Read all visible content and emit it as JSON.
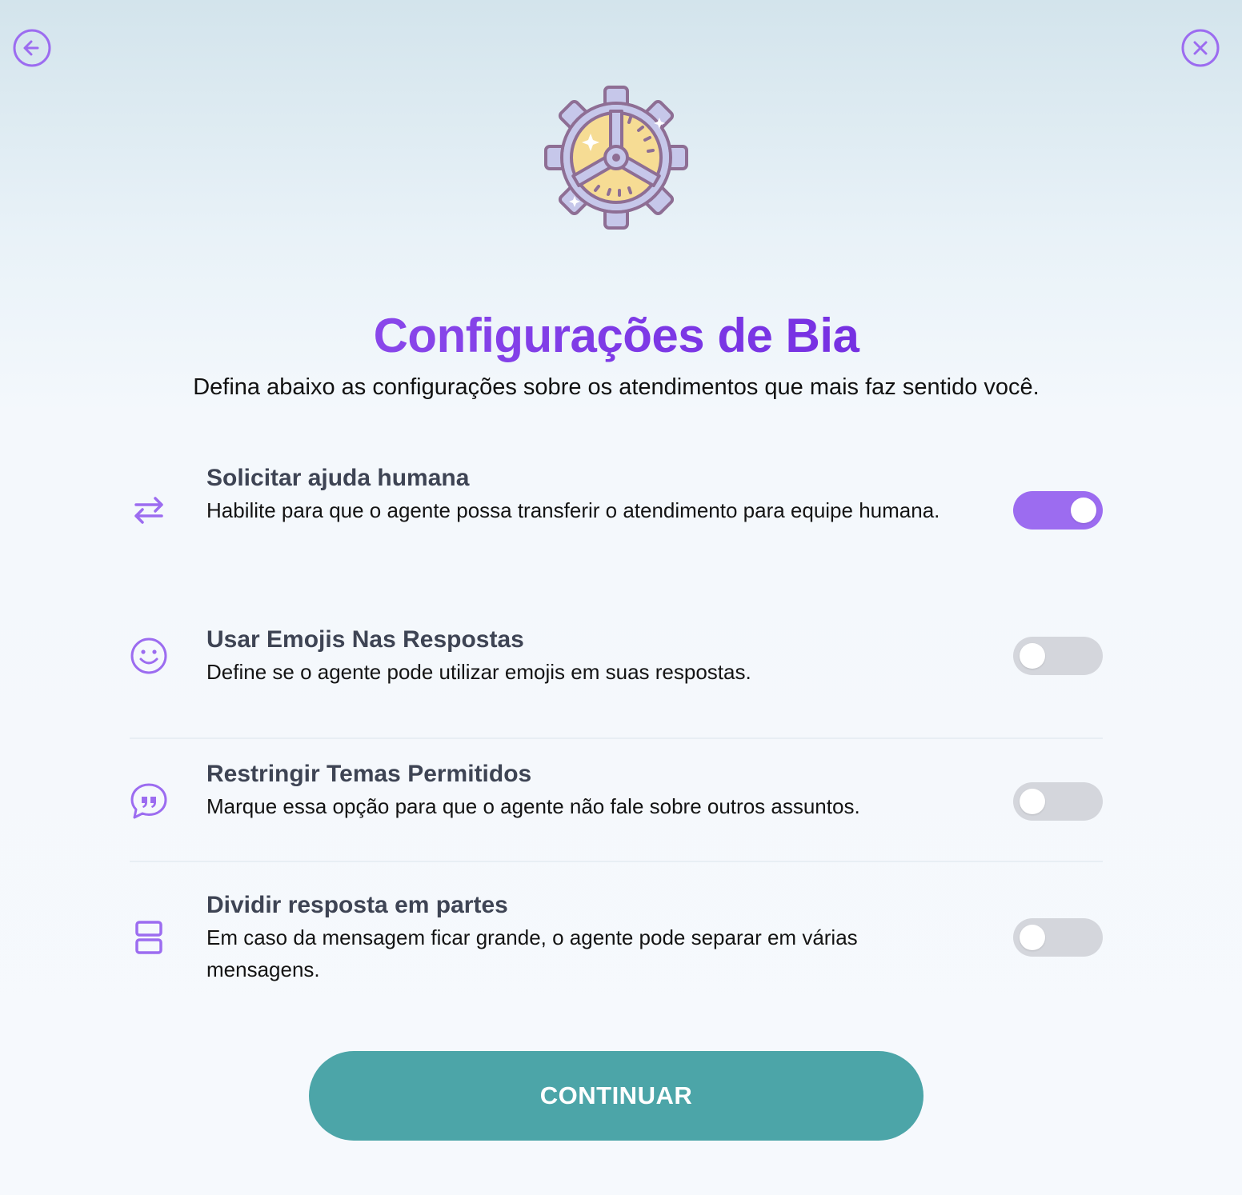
{
  "nav": {
    "back_icon": "arrow-left-circle-icon",
    "close_icon": "x-circle-icon"
  },
  "hero": {
    "icon": "gear-settings-icon",
    "title": "Configurações de Bia",
    "subtitle": "Defina abaixo as configurações sobre os atendimentos que mais faz sentido você."
  },
  "settings": [
    {
      "icon": "transfer-arrows-icon",
      "title": "Solicitar ajuda humana",
      "description": "Habilite para que o agente possa transferir o atendimento para equipe humana.",
      "enabled": true
    },
    {
      "icon": "smiley-face-icon",
      "title": "Usar Emojis Nas Respostas",
      "description": "Define se o agente pode utilizar emojis em suas respostas.",
      "enabled": false
    },
    {
      "icon": "quote-bubble-icon",
      "title": "Restringir Temas Permitidos",
      "description": "Marque essa opção para que o agente não fale sobre outros assuntos.",
      "enabled": false
    },
    {
      "icon": "split-rows-icon",
      "title": "Dividir resposta em partes",
      "description": "Em caso da mensagem ficar grande, o agente pode separar em várias mensagens.",
      "enabled": false
    }
  ],
  "actions": {
    "continue_label": "CONTINUAR"
  },
  "colors": {
    "accent_purple": "#9c6cf0",
    "title_gradient_start": "#9b5cf0",
    "title_gradient_end": "#6a22dc",
    "button_teal": "#4ca5a8",
    "toggle_off": "#d4d6dc",
    "setting_title": "#3e4454"
  }
}
